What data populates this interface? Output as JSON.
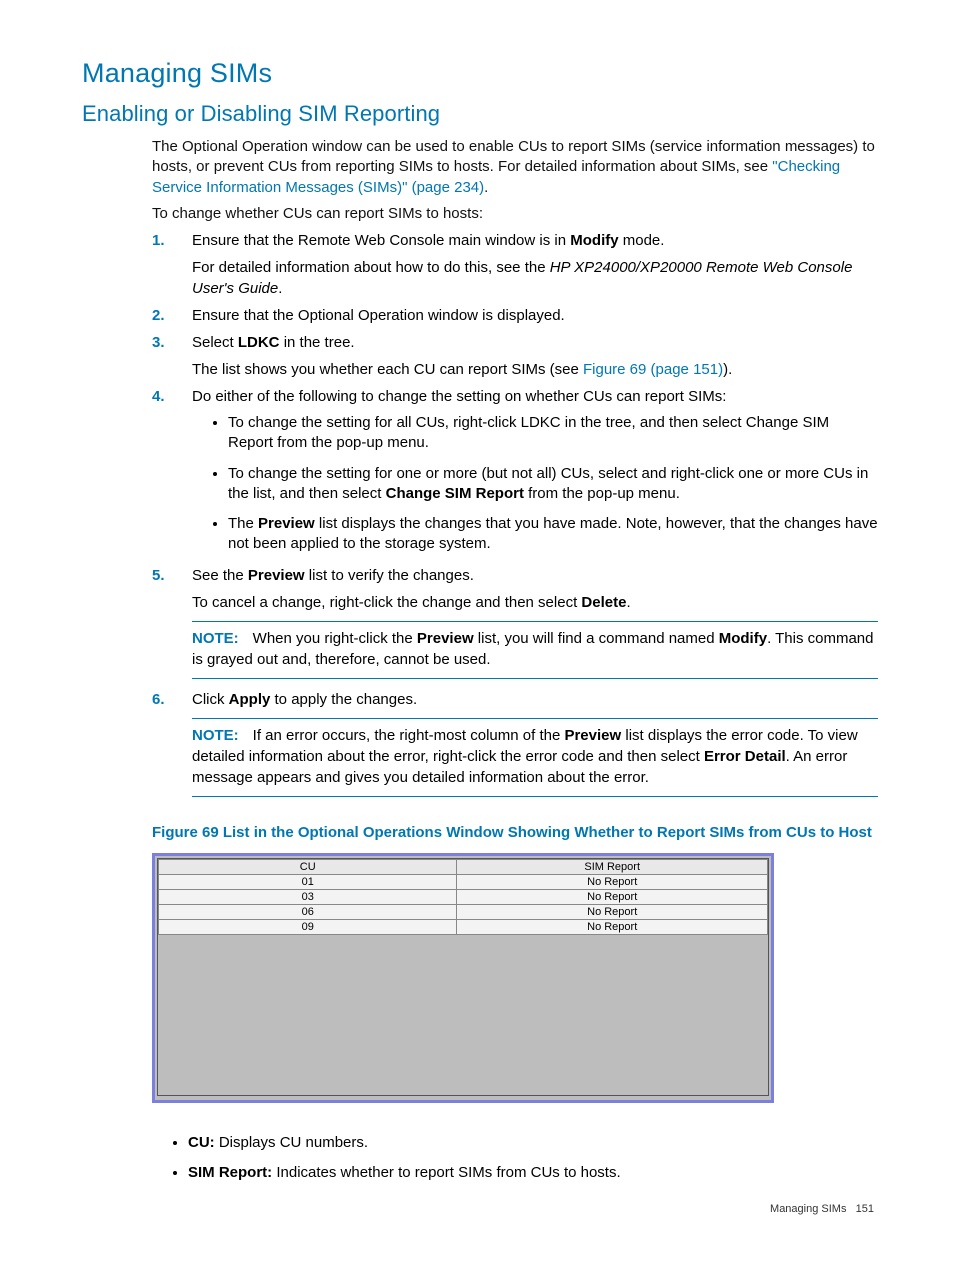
{
  "h1": "Managing SIMs",
  "h2": "Enabling or Disabling SIM Reporting",
  "intro_1a": "The Optional Operation window can be used to enable CUs to report SIMs (service information messages) to hosts, or prevent CUs from reporting SIMs to hosts. For detailed information about SIMs, see ",
  "intro_link": "\"Checking Service Information Messages (SIMs)\" (page 234)",
  "intro_1b": ".",
  "intro_2": "To change whether CUs can report SIMs to hosts:",
  "steps": {
    "s1_num": "1.",
    "s1_a": "Ensure that the Remote Web Console main window is in ",
    "s1_bold": "Modify",
    "s1_b": " mode.",
    "s1_detail_a": "For detailed information about how to do this, see the ",
    "s1_detail_ital": "HP XP24000/XP20000 Remote Web Console User's Guide",
    "s1_detail_b": ".",
    "s2_num": "2.",
    "s2": "Ensure that the Optional Operation window is displayed.",
    "s3_num": "3.",
    "s3_a": "Select ",
    "s3_bold": "LDKC",
    "s3_b": " in the tree.",
    "s3_detail_a": "The list shows you whether each CU can report SIMs (see ",
    "s3_link": "Figure 69 (page 151)",
    "s3_detail_b": ").",
    "s4_num": "4.",
    "s4": "Do either of the following to change the setting on whether CUs can report SIMs:",
    "s4_b1": "To change the setting for all CUs, right-click LDKC in the tree, and then select Change SIM Report from the pop-up menu.",
    "s4_b2_a": "To change the setting for one or more (but not all) CUs, select and right-click one or more CUs in the list, and then select ",
    "s4_b2_bold": "Change SIM Report",
    "s4_b2_b": " from the pop-up menu.",
    "s4_b3_a": "The ",
    "s4_b3_bold": "Preview",
    "s4_b3_b": " list displays the changes that you have made. Note, however, that the changes have not been applied to the storage system.",
    "s5_num": "5.",
    "s5_a": "See the ",
    "s5_bold": "Preview",
    "s5_b": " list to verify the changes.",
    "s5_detail_a": "To cancel a change, right-click the change and then select ",
    "s5_detail_bold": "Delete",
    "s5_detail_b": ".",
    "note1_label": "NOTE:",
    "note1_a": "When you right-click the ",
    "note1_bold1": "Preview",
    "note1_b": " list, you will find a command named ",
    "note1_bold2": "Modify",
    "note1_c": ". This command is grayed out and, therefore, cannot be used.",
    "s6_num": "6.",
    "s6_a": "Click ",
    "s6_bold": "Apply",
    "s6_b": " to apply the changes.",
    "note2_label": "NOTE:",
    "note2_a": "If an error occurs, the right-most column of the ",
    "note2_bold1": "Preview",
    "note2_b": " list displays the error code. To view detailed information about the error, right-click the error code and then select ",
    "note2_bold2": "Error Detail",
    "note2_c": ". An error message appears and gives you detailed information about the error."
  },
  "fig_caption": "Figure 69 List in the Optional Operations Window Showing Whether to Report SIMs from CUs to Host",
  "chart_data": {
    "type": "table",
    "columns": [
      "CU",
      "SIM Report"
    ],
    "rows": [
      [
        "01",
        "No Report"
      ],
      [
        "03",
        "No Report"
      ],
      [
        "06",
        "No Report"
      ],
      [
        "09",
        "No Report"
      ]
    ]
  },
  "defs": {
    "d1_bold": "CU:",
    "d1": " Displays CU numbers.",
    "d2_bold": "SIM Report:",
    "d2": " Indicates whether to report SIMs from CUs to hosts."
  },
  "footer_text": "Managing SIMs",
  "footer_page": "151"
}
